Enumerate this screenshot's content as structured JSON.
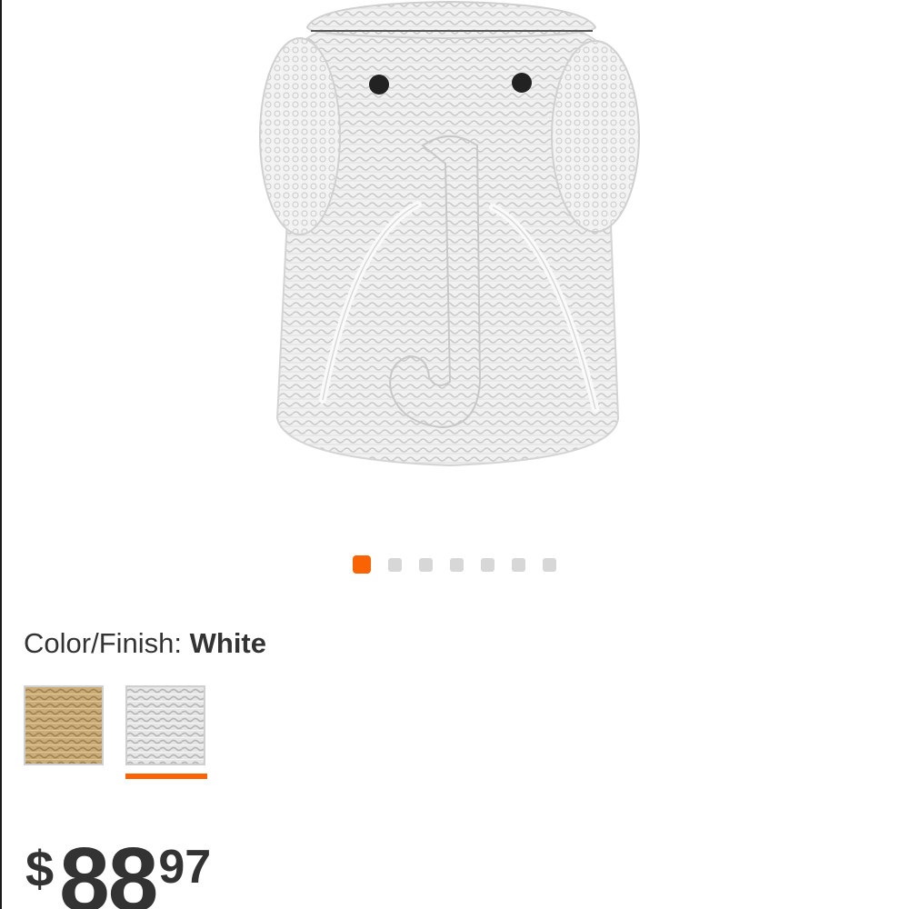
{
  "product": {
    "image_alt": "elephant wicker hamper"
  },
  "carousel": {
    "total": 7,
    "active_index": 0
  },
  "color_finish": {
    "label": "Color/Finish:",
    "selected": "White",
    "swatches": [
      {
        "name": "natural",
        "selected": false
      },
      {
        "name": "white",
        "selected": true
      }
    ]
  },
  "price": {
    "currency": "$",
    "dollars": "88",
    "cents": "97"
  },
  "colors": {
    "accent": "#f96302",
    "dot_inactive": "#d7d7d7",
    "text": "#333333"
  }
}
